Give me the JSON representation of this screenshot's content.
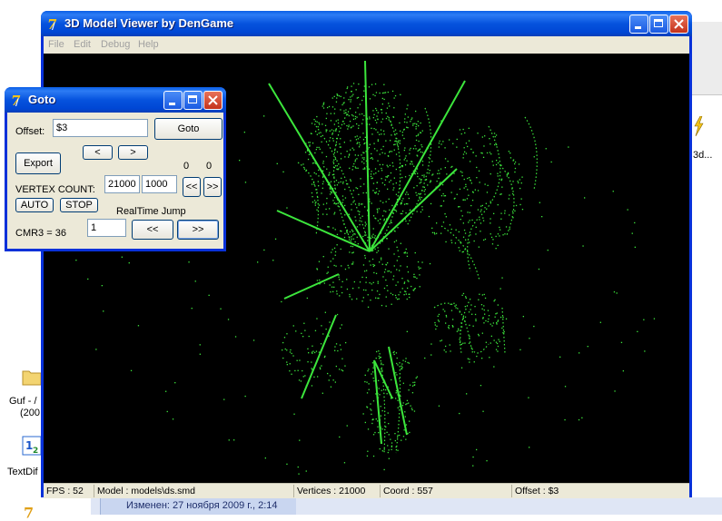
{
  "main_window": {
    "title": "3D Model Viewer by DenGame",
    "menu": [
      "File",
      "Edit",
      "Debug",
      "Help"
    ],
    "status": {
      "fps": "FPS : 52",
      "model": "Model : models\\ds.smd",
      "vertices": "Vertices : 21000",
      "coord": "Coord : 557",
      "offset": "Offset : $3"
    }
  },
  "goto_dialog": {
    "title": "Goto",
    "offset_label": "Offset:",
    "offset_value": "$3",
    "goto_label": "Goto",
    "prev_label": "<",
    "next_label": ">",
    "export_label": "Export",
    "counter_left": "0",
    "counter_right": "0",
    "vertex_count_label": "VERTEX COUNT:",
    "vertex_count_value": "21000",
    "vertex_step_value": "1000",
    "rewind_label": "<<",
    "forward_label": ">>",
    "auto_label": "AUTO",
    "stop_label": "STOP",
    "realtime_label": "RealTime Jump",
    "cmr_label": "CMR3 = 36",
    "jump_value": "1",
    "jump_back_label": "<<",
    "jump_fwd_label": ">>"
  },
  "desktop": {
    "bottom_info": "Изменен: 27 ноября 2009 г., 2:14",
    "icon1_label": "Guf - /",
    "icon1_sub": "(200",
    "icon2_label": "TextDif",
    "right_label": "3d..."
  },
  "colors": {
    "title_blue": "#0653de",
    "point_green": "#3ce63c",
    "close_red": "#c4321b"
  }
}
